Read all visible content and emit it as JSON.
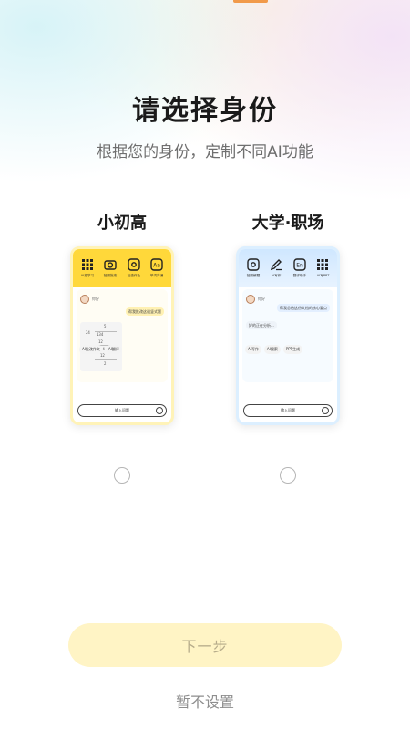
{
  "page": {
    "title": "请选择身份",
    "subtitle": "根据您的身份，定制不同AI功能",
    "next_label": "下一步",
    "skip_label": "暂不设置"
  },
  "options": [
    {
      "label": "小初高",
      "tools": [
        "AI拍学习",
        "拍照批改",
        "检查作业",
        "单词背诵"
      ],
      "avatar_name": "你好",
      "bubble_right": "帮我批改这道竖式题",
      "chips": [
        "AI批改作文",
        "AI翻译"
      ],
      "input_label": "输入问题",
      "selected": false
    },
    {
      "label": "大学·职场",
      "tools": [
        "拍照解题",
        "AI写作",
        "翻译助手",
        "AI写PPT"
      ],
      "avatar_name": "你好",
      "bubble_right": "帮我总结这份文档的核心要点",
      "bubble_left": "好的正在分析...",
      "chips": [
        "AI写作",
        "AI搜索",
        "PPT生成"
      ],
      "input_label": "输入问题",
      "selected": false
    }
  ],
  "colors": {
    "accent_yellow": "#ffd83a",
    "accent_blue": "#cfe7ff",
    "button_disabled_bg": "#fff4c5",
    "button_disabled_text": "#b6ab8a"
  }
}
